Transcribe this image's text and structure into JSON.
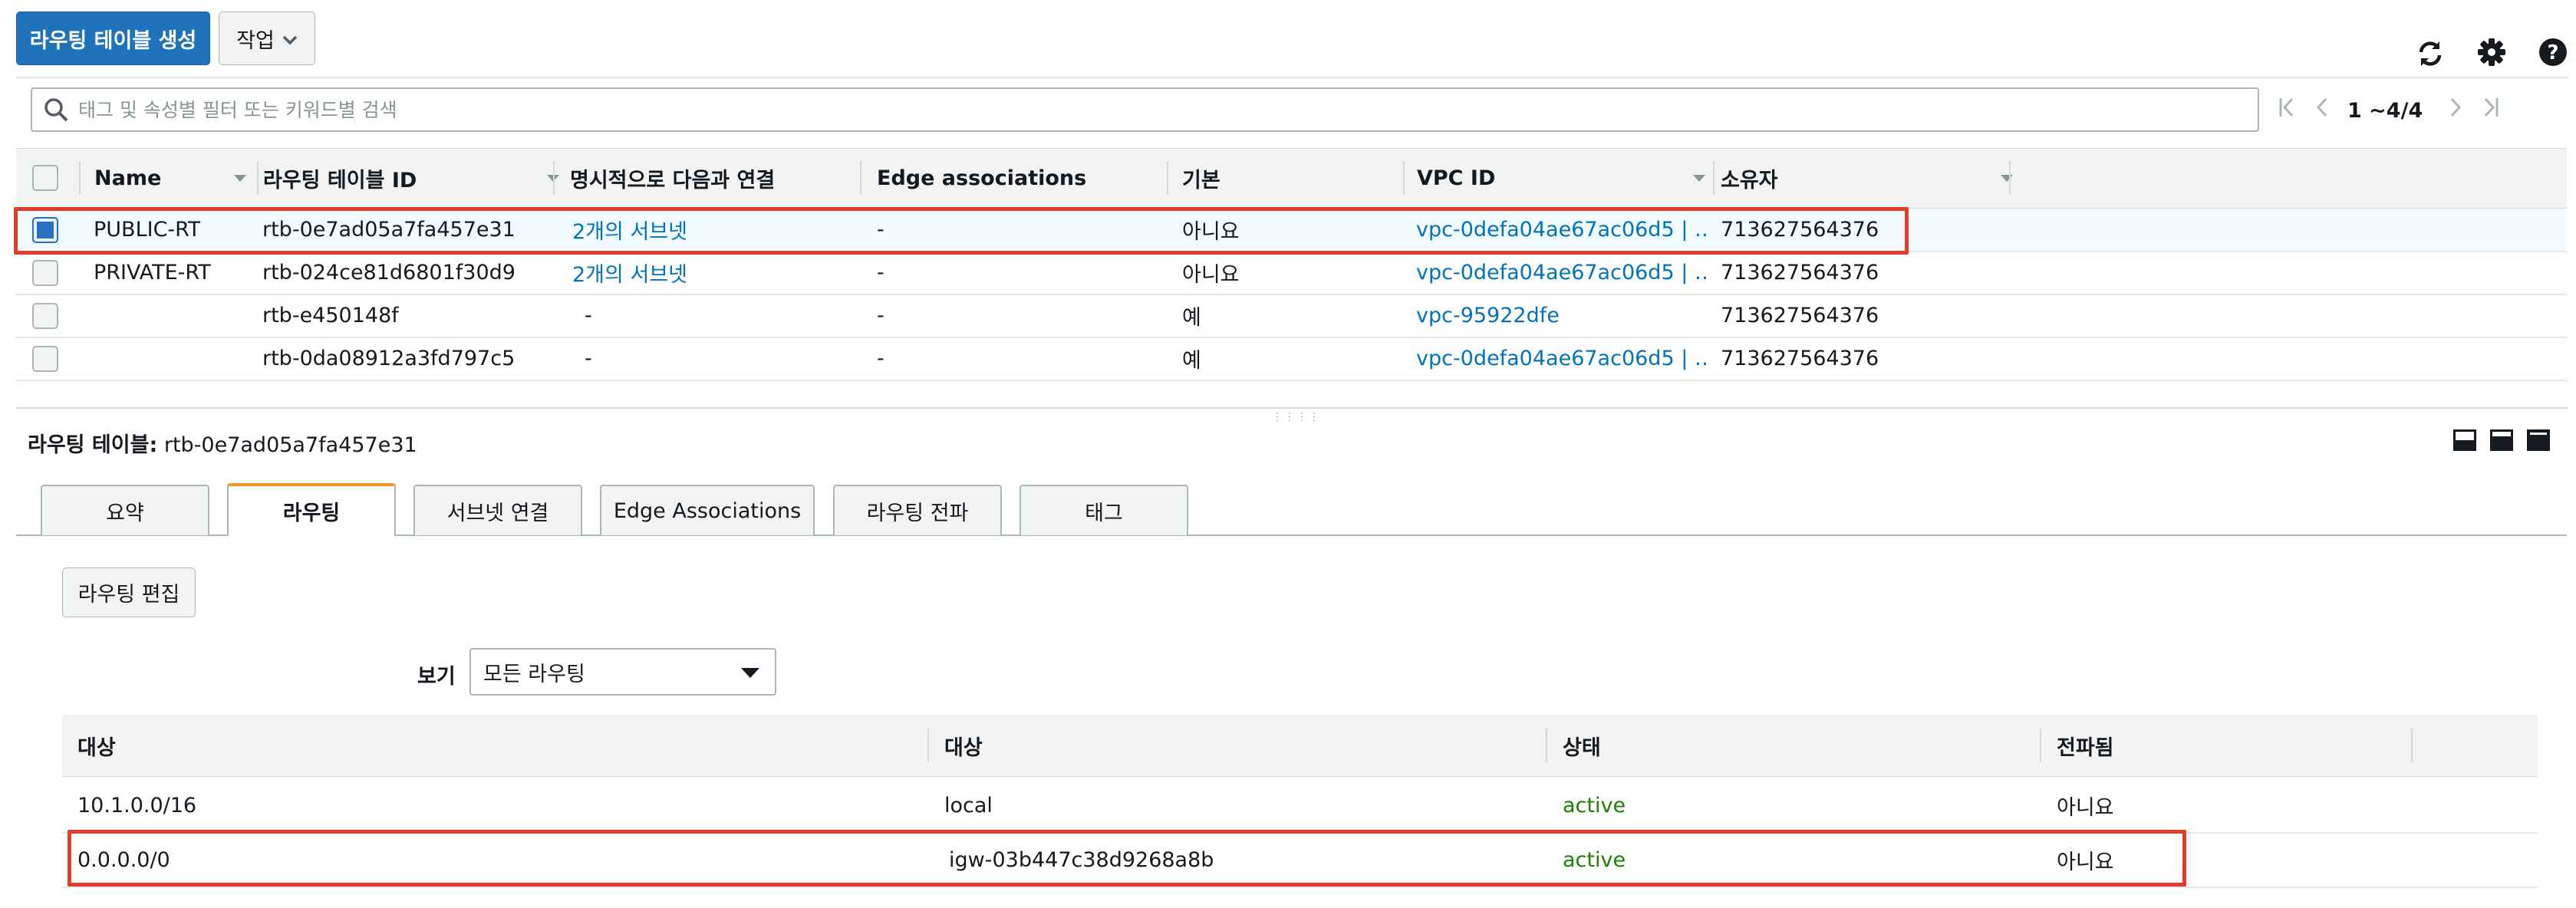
{
  "toolbar": {
    "create_label": "라우팅 테이블 생성",
    "actions_label": "작업",
    "refresh_icon": "refresh-icon",
    "settings_icon": "gear-icon",
    "help_icon": "help-icon"
  },
  "search": {
    "placeholder": "태그 및 속성별 필터 또는 키워드별 검색"
  },
  "pagination": {
    "range": "1 ~4/4"
  },
  "table": {
    "headers": [
      "Name",
      "라우팅 테이블 ID",
      "명시적으로 다음과 연결",
      "Edge associations",
      "기본",
      "VPC ID",
      "소유자"
    ],
    "rows": [
      {
        "name": "PUBLIC-RT",
        "id": "rtb-0e7ad05a7fa457e31",
        "subnets": "2개의 서브넷",
        "edge": "-",
        "main": "아니요",
        "vpc": "vpc-0defa04ae67ac06d5 | …",
        "owner": "713627564376",
        "selected": true
      },
      {
        "name": "PRIVATE-RT",
        "id": "rtb-024ce81d6801f30d9",
        "subnets": "2개의 서브넷",
        "edge": "-",
        "main": "아니요",
        "vpc": "vpc-0defa04ae67ac06d5 | …",
        "owner": "713627564376",
        "selected": false
      },
      {
        "name": "",
        "id": "rtb-e450148f",
        "subnets": "-",
        "edge": "-",
        "main": "예",
        "vpc": "vpc-95922dfe",
        "owner": "713627564376",
        "selected": false
      },
      {
        "name": "",
        "id": "rtb-0da08912a3fd797c5",
        "subnets": "-",
        "edge": "-",
        "main": "예",
        "vpc": "vpc-0defa04ae67ac06d5 | …",
        "owner": "713627564376",
        "selected": false
      }
    ]
  },
  "detail": {
    "title_label": "라우팅 테이블:",
    "title_value": "rtb-0e7ad05a7fa457e31",
    "tabs": [
      "요약",
      "라우팅",
      "서브넷 연결",
      "Edge Associations",
      "라우팅 전파",
      "태그"
    ],
    "active_tab": "라우팅",
    "edit_label": "라우팅 편집",
    "view_label": "보기",
    "view_value": "모든 라우팅",
    "route_headers": [
      "대상",
      "대상",
      "상태",
      "전파됨"
    ],
    "routes": [
      {
        "destination": "10.1.0.0/16",
        "target": "local",
        "status": "active",
        "propagated": "아니요"
      },
      {
        "destination": "0.0.0.0/0",
        "target": "igw-03b447c38d9268a8b",
        "status": "active",
        "propagated": "아니요"
      }
    ]
  },
  "colors": {
    "primary": "#1e73bb",
    "link": "#0073bb",
    "active": "#1d8102",
    "highlight": "#e03e2a",
    "tab_accent": "#f09a29"
  }
}
